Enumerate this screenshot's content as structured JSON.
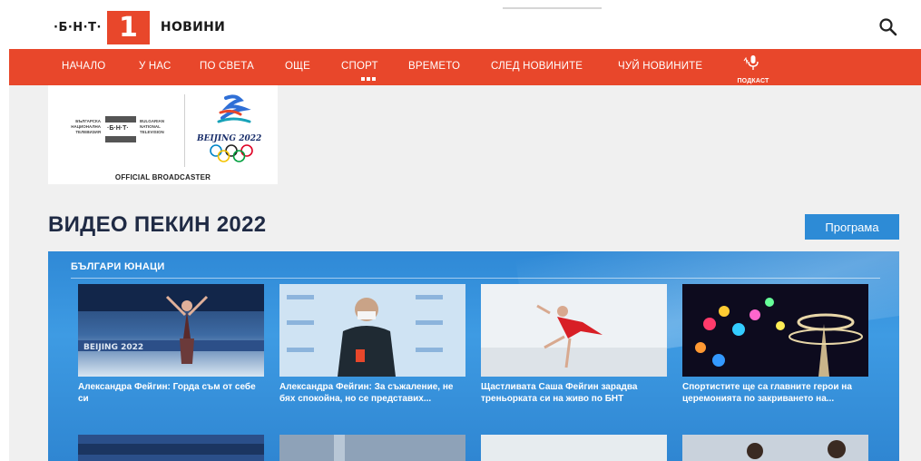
{
  "header": {
    "logo_prefix": "·Б·Н·Т·",
    "logo_number": "1",
    "logo_section": "НОВИНИ",
    "search_icon": "search-icon"
  },
  "nav": {
    "items": [
      {
        "label": "НАЧАЛО"
      },
      {
        "label": "У НАС"
      },
      {
        "label": "ПО СВЕТА"
      },
      {
        "label": "ОЩЕ"
      },
      {
        "label": "СПОРТ"
      },
      {
        "label": "ВРЕМЕТО"
      },
      {
        "label": "СЛЕД НОВИНИТЕ"
      },
      {
        "label": "ЧУЙ НОВИНИТЕ"
      }
    ],
    "active": "СПОРТ",
    "podcast_label": "ПОДКАСТ"
  },
  "banner": {
    "bnt_left": "БЪЛГАРСКА\nНАЦИОНАЛНА\nТЕЛЕВИЗИЯ",
    "bnt_mark": "·Б·Н·Т·",
    "bnt_right": "BULGARIAN\nNATIONAL\nTELEVISION",
    "beijing": "BEIJING 2022",
    "broadcaster": "OFFICIAL BROADCASTER"
  },
  "page": {
    "title": "ВИДЕО ПЕКИН 2022",
    "program_button": "Програма"
  },
  "video_section": {
    "label": "БЪЛГАРИ ЮНАЦИ",
    "cards": [
      {
        "title": "Александра Фейгин: Горда съм от себе си"
      },
      {
        "title": "Александра Фейгин: За съжаление, не бях спокойна, но се представих..."
      },
      {
        "title": "Щастливата Саша Фейгин зарадва треньорката си на живо по БНТ"
      },
      {
        "title": "Спортистите ще са главните герои на церемонията по закриването на..."
      }
    ]
  },
  "colors": {
    "brand_red": "#e8472b",
    "nav_bg": "#e8472b",
    "button_blue": "#2d8bd6",
    "section_blue": "#2f89d6",
    "title_dark": "#1f2a44"
  }
}
